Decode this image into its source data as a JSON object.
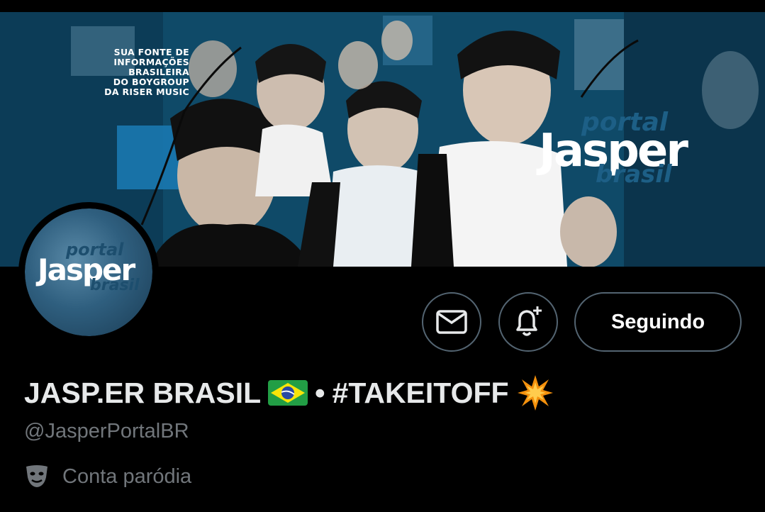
{
  "banner": {
    "tagline": [
      "SUA FONTE DE",
      "INFORMAÇÕES",
      "BRASILEIRA",
      "DO BOYGROUP",
      "DA RISER MUSIC"
    ],
    "logo": {
      "portal": "portal",
      "jasper": "Jasper",
      "brasil": "brasil"
    }
  },
  "avatar": {
    "portal": "portal",
    "jasper": "Jasper",
    "brasil": "brasil"
  },
  "actions": {
    "message_icon": "envelope-icon",
    "notify_icon": "bell-plus-icon",
    "follow_label": "Seguindo"
  },
  "profile": {
    "name_part1": "JASP.ER BRASIL",
    "flag_icon": "brazil-flag-emoji",
    "name_separator": "•",
    "name_part2": "#TAKEITOFF",
    "burst_icon": "collision-emoji",
    "handle": "@JasperPortalBR",
    "parody_icon": "theater-mask-icon",
    "parody_label": "Conta paródia"
  },
  "colors": {
    "background": "#000000",
    "border": "#536471",
    "muted_text": "#71767b",
    "banner_blue": "#12587a"
  }
}
